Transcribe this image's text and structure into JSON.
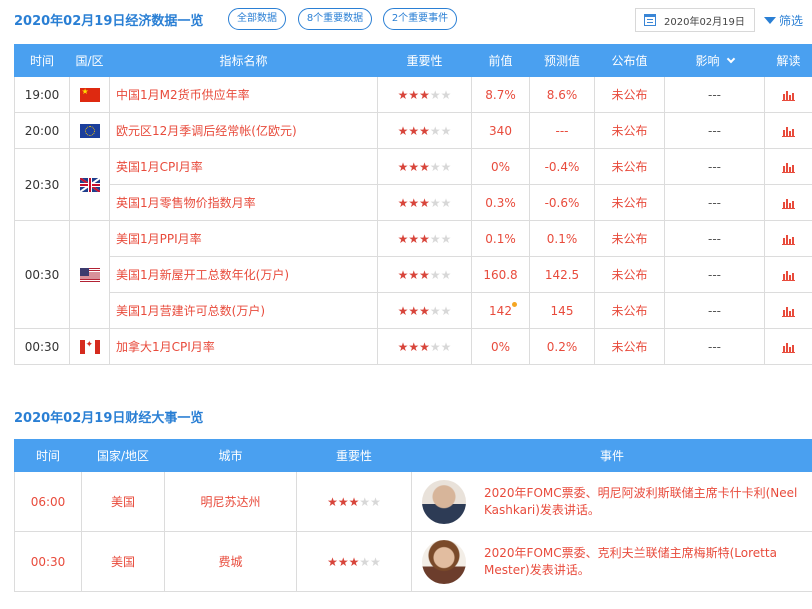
{
  "header": {
    "title": "2020年02月19日经济数据一览",
    "filters": [
      "全部数据",
      "8个重要数据",
      "2个重要事件"
    ],
    "date": "2020年02月19日",
    "filter_label": "筛选"
  },
  "econ_table": {
    "columns": [
      "时间",
      "国/区",
      "指标名称",
      "重要性",
      "前值",
      "预测值",
      "公布值",
      "影响",
      "解读"
    ],
    "groups": [
      {
        "time": "19:00",
        "flag": "china-flag-icon",
        "rows": [
          {
            "name": "中国1月M2货币供应年率",
            "stars": 3,
            "prev": "8.7%",
            "forecast": "8.6%",
            "actual": "未公布",
            "impact": "---"
          }
        ]
      },
      {
        "time": "20:00",
        "flag": "eu-flag-icon",
        "rows": [
          {
            "name": "欧元区12月季调后经常帐(亿欧元)",
            "stars": 3,
            "prev": "340",
            "forecast": "---",
            "actual": "未公布",
            "impact": "---"
          }
        ]
      },
      {
        "time": "20:30",
        "flag": "uk-flag-icon",
        "rows": [
          {
            "name": "英国1月CPI月率",
            "stars": 3,
            "prev": "0%",
            "forecast": "-0.4%",
            "actual": "未公布",
            "impact": "---"
          },
          {
            "name": "英国1月零售物价指数月率",
            "stars": 3,
            "prev": "0.3%",
            "forecast": "-0.6%",
            "actual": "未公布",
            "impact": "---"
          }
        ]
      },
      {
        "time": "00:30",
        "flag": "us-flag-icon",
        "rows": [
          {
            "name": "美国1月PPI月率",
            "stars": 3,
            "prev": "0.1%",
            "forecast": "0.1%",
            "actual": "未公布",
            "impact": "---"
          },
          {
            "name": "美国1月新屋开工总数年化(万户)",
            "stars": 3,
            "prev": "160.8",
            "forecast": "142.5",
            "actual": "未公布",
            "impact": "---"
          },
          {
            "name": "美国1月营建许可总数(万户)",
            "stars": 3,
            "prev": "142",
            "forecast": "145",
            "actual": "未公布",
            "impact": "---"
          }
        ]
      },
      {
        "time": "00:30",
        "flag": "canada-flag-icon",
        "rows": [
          {
            "name": "加拿大1月CPI月率",
            "stars": 3,
            "prev": "0%",
            "forecast": "0.2%",
            "actual": "未公布",
            "impact": "---"
          }
        ]
      }
    ]
  },
  "events": {
    "title": "2020年02月19日财经大事一览",
    "columns": [
      "时间",
      "国家/地区",
      "城市",
      "重要性",
      "事件"
    ],
    "rows": [
      {
        "time": "06:00",
        "country": "美国",
        "city": "明尼苏达州",
        "stars": 3,
        "event": "2020年FOMC票委、明尼阿波利斯联储主席卡什卡利(Neel Kashkari)发表讲话。"
      },
      {
        "time": "00:30",
        "country": "美国",
        "city": "费城",
        "stars": 3,
        "event": "2020年FOMC票委、克利夫兰联储主席梅斯特(Loretta Mester)发表讲话。"
      }
    ]
  },
  "colors": {
    "accent": "#2a7fd4",
    "header_bg": "#4aa0f0",
    "value_red": "#e84b3c",
    "star_on": "#d8453b",
    "star_off": "#d8d8d8"
  }
}
